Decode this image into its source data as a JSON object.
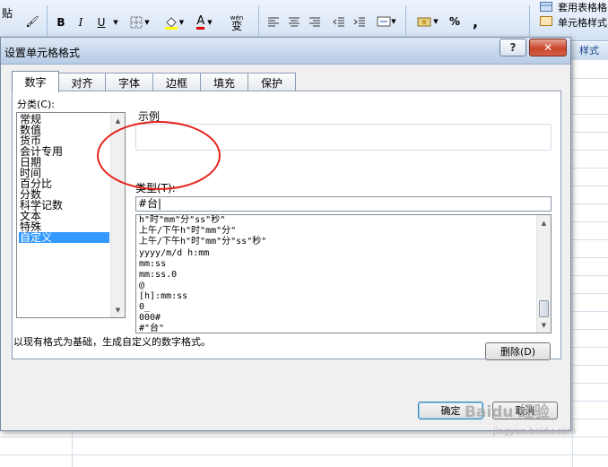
{
  "ribbon": {
    "paste_label": "贴",
    "bold": "B",
    "italic": "I",
    "underline": "U",
    "font_color_letter": "A",
    "phonetic_label": "wén",
    "phonetic_char": "变",
    "percent": "%",
    "comma": ",",
    "cell_style_label": "单元格样式",
    "table_format_label": "套用表格格",
    "style_tab": "样式"
  },
  "dialog": {
    "title": "设置单元格格式",
    "help_label": "?",
    "close_label": "✕",
    "tabs": [
      {
        "label": "数字",
        "active": true
      },
      {
        "label": "对齐",
        "active": false
      },
      {
        "label": "字体",
        "active": false
      },
      {
        "label": "边框",
        "active": false
      },
      {
        "label": "填充",
        "active": false
      },
      {
        "label": "保护",
        "active": false
      }
    ],
    "category_label": "分类(C):",
    "categories": [
      {
        "label": "常规",
        "selected": false
      },
      {
        "label": "数值",
        "selected": false
      },
      {
        "label": "货币",
        "selected": false
      },
      {
        "label": "会计专用",
        "selected": false
      },
      {
        "label": "日期",
        "selected": false
      },
      {
        "label": "时间",
        "selected": false
      },
      {
        "label": "百分比",
        "selected": false
      },
      {
        "label": "分数",
        "selected": false
      },
      {
        "label": "科学记数",
        "selected": false
      },
      {
        "label": "文本",
        "selected": false
      },
      {
        "label": "特殊",
        "selected": false
      },
      {
        "label": "自定义",
        "selected": true
      }
    ],
    "sample_label": "示例",
    "sample_value": "",
    "type_label": "类型(T):",
    "type_value": "#台|",
    "formats": [
      "h\"时\"mm\"分\"ss\"秒\"",
      "上午/下午h\"时\"mm\"分\"",
      "上午/下午h\"时\"mm\"分\"ss\"秒\"",
      "yyyy/m/d h:mm",
      "mm:ss",
      "mm:ss.0",
      "@",
      "[h]:mm:ss",
      "0_",
      "000#",
      "#\"台\""
    ],
    "delete_button": "删除(D)",
    "description": "以现有格式为基础，生成自定义的数字格式。",
    "ok_button": "确定",
    "cancel_button": "取消"
  },
  "watermark": {
    "brand": "Baidu 经验",
    "url": "jingyan.baidu.com"
  },
  "colors": {
    "selection": "#3399ff",
    "highlight_ring": "#e5221a",
    "close_button": "#c9452c"
  }
}
